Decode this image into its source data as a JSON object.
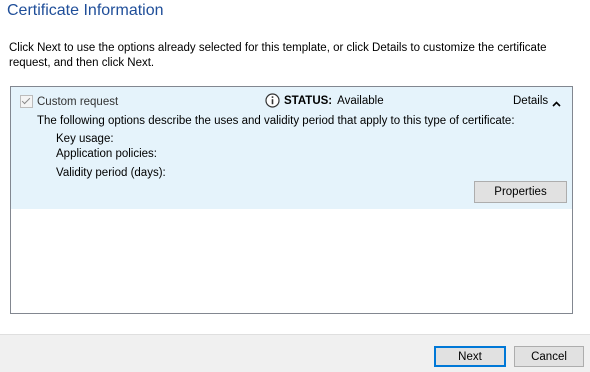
{
  "header": {
    "title": "Certificate Information"
  },
  "instructions": "Click Next to use the options already selected for this template, or click Details to customize the certificate request, and then click Next.",
  "certificate": {
    "checkbox_label": "Custom request",
    "checked": true,
    "status_label": "STATUS:",
    "status_value": "Available",
    "details_label": "Details",
    "description": "The following options describe the uses and validity period that apply to this type of certificate:",
    "properties": [
      {
        "label": "Key usage:"
      },
      {
        "label": "Application policies:"
      },
      {
        "label": "Validity period (days):"
      }
    ],
    "properties_button": "Properties"
  },
  "footer": {
    "next_label": "Next",
    "cancel_label": "Cancel"
  },
  "icons": {
    "status": "info-icon",
    "details_toggle": "chevron-up-icon"
  },
  "colors": {
    "title": "#1f4e99",
    "item_background": "#e5f3fb",
    "default_button_border": "#0078d7"
  }
}
